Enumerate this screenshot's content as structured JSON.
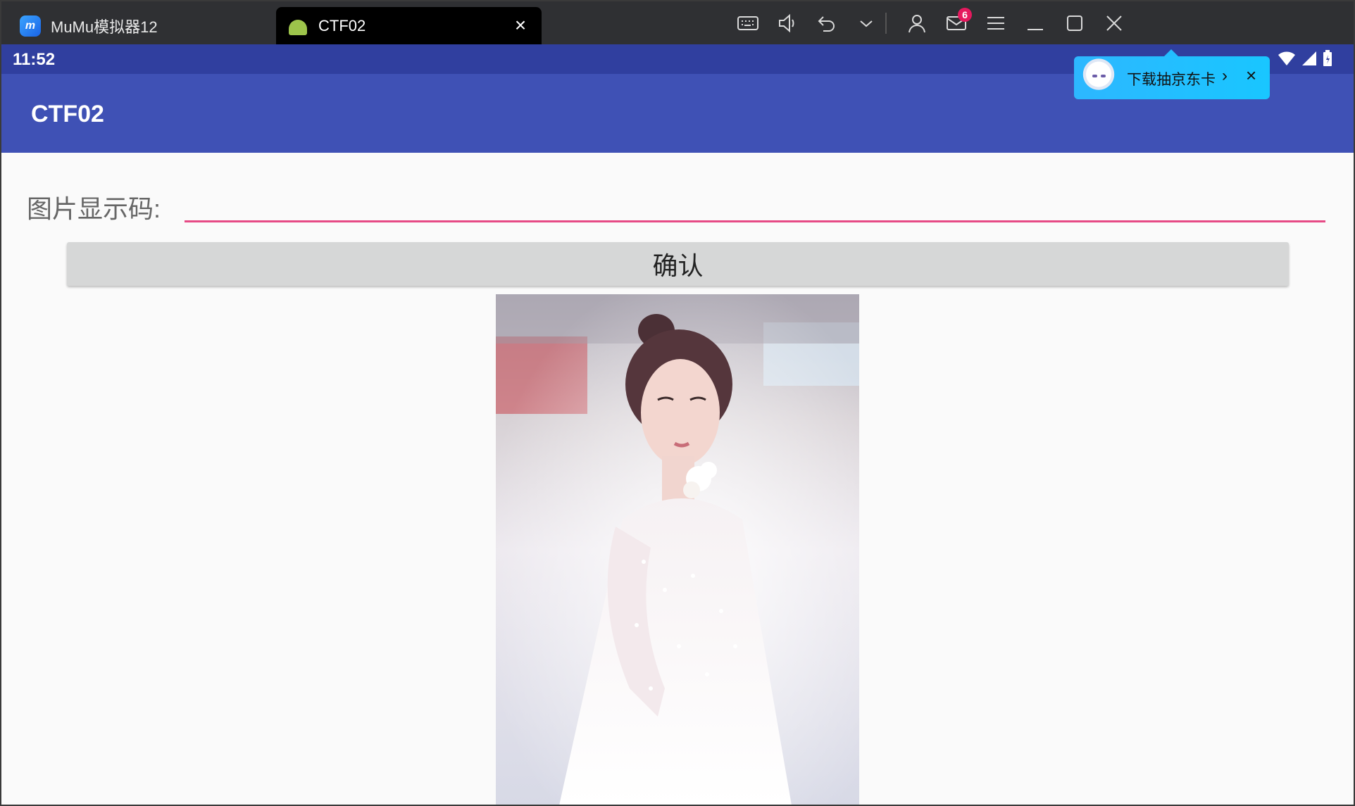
{
  "emulator": {
    "home_tab_label": "MuMu模拟器12",
    "active_tab_label": "CTF02",
    "mail_badge_count": "6",
    "toolbar_icons": [
      "keyboard-icon",
      "volume-icon",
      "back-icon",
      "chevron-down-icon",
      "user-icon",
      "mail-icon",
      "menu-icon",
      "minimize-icon",
      "maximize-icon",
      "close-icon"
    ]
  },
  "status_bar": {
    "time": "11:52",
    "icons": [
      "wifi-icon",
      "signal-icon",
      "battery-icon"
    ]
  },
  "promo": {
    "text": "下载抽京东卡"
  },
  "app": {
    "title": "CTF02",
    "code_label": "图片显示码:",
    "code_value": "",
    "confirm_label": "确认",
    "primary_color": "#3f51b5",
    "primary_dark_color": "#303f9f",
    "accent_color": "#e64a85"
  }
}
